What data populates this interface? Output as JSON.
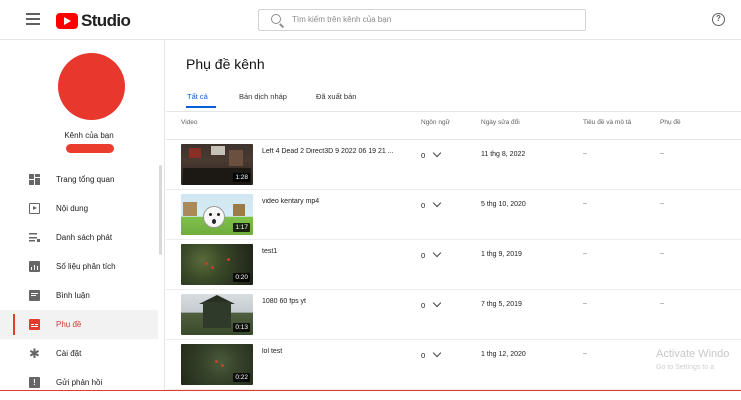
{
  "header": {
    "logo_text": "Studio",
    "search_placeholder": "Tìm kiếm trên kênh của bạn"
  },
  "sidebar": {
    "channel_label": "Kênh của bạn",
    "items": [
      {
        "label": "Trang tổng quan",
        "icon": "dashboard-icon"
      },
      {
        "label": "Nội dung",
        "icon": "content-icon"
      },
      {
        "label": "Danh sách phát",
        "icon": "playlist-icon"
      },
      {
        "label": "Số liệu phân tích",
        "icon": "analytics-icon"
      },
      {
        "label": "Bình luận",
        "icon": "comments-icon"
      },
      {
        "label": "Phụ đề",
        "icon": "subtitles-icon",
        "active": true
      },
      {
        "label": "Cài đặt",
        "icon": "settings-icon"
      },
      {
        "label": "Gửi phản hồi",
        "icon": "feedback-icon"
      }
    ]
  },
  "main": {
    "title": "Phụ đề kênh",
    "tabs": [
      {
        "label": "Tất cả",
        "active": true
      },
      {
        "label": "Bản dịch nháp"
      },
      {
        "label": "Đã xuất bản"
      }
    ],
    "columns": [
      "Video",
      "Ngôn ngữ",
      "Ngày sửa đổi",
      "Tiêu đề và mô tả",
      "Phụ đề"
    ],
    "rows": [
      {
        "title": "Left 4 Dead 2 Direct3D 9 2022 06 19 21 ...",
        "duration": "1:28",
        "languages": "0",
        "modified": "11 thg 8, 2022",
        "title_desc": "–",
        "subtitles": "–"
      },
      {
        "title": "video kentary mp4",
        "duration": "1:17",
        "languages": "0",
        "modified": "5 thg 10, 2020",
        "title_desc": "–",
        "subtitles": "–"
      },
      {
        "title": "test1",
        "duration": "0:20",
        "languages": "0",
        "modified": "1 thg 9, 2019",
        "title_desc": "–",
        "subtitles": "–"
      },
      {
        "title": "1080 60 fps yt",
        "duration": "0:13",
        "languages": "0",
        "modified": "7 thg 5, 2019",
        "title_desc": "–",
        "subtitles": "–"
      },
      {
        "title": "lol test",
        "duration": "0:22",
        "languages": "0",
        "modified": "1 thg 12, 2020",
        "title_desc": "–",
        "subtitles": ""
      }
    ]
  },
  "watermark": {
    "line1": "Activate Windo",
    "line2": "Go to Settings to a"
  },
  "colors": {
    "brand_red": "#ff0000",
    "accent_blue": "#065fd4",
    "avatar_red": "#e8372c"
  }
}
